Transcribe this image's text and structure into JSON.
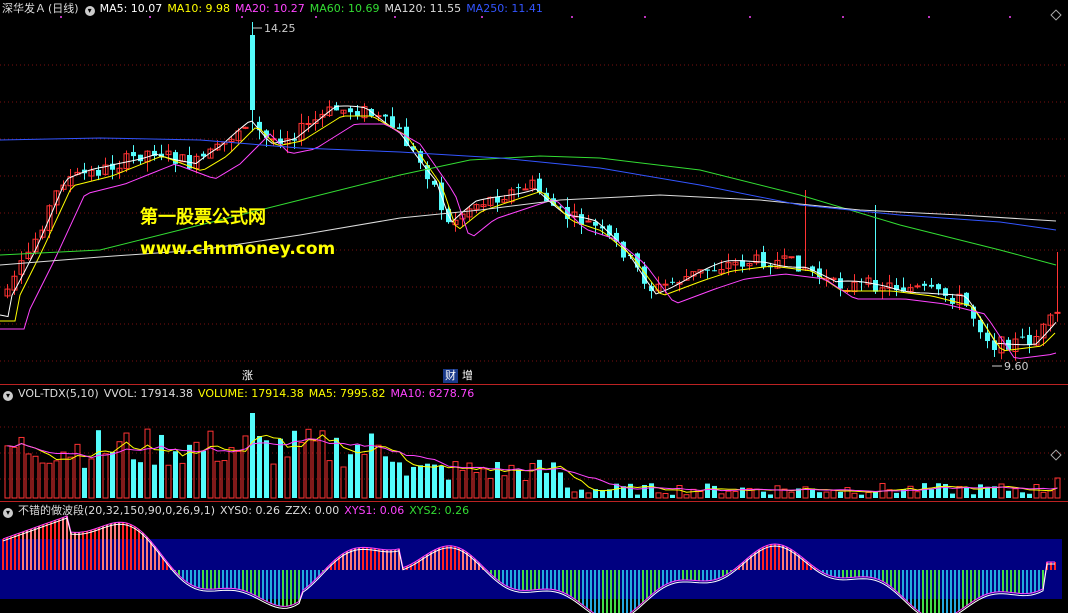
{
  "main": {
    "stock_name": "深华发Ａ",
    "period": "(日线)",
    "ma_labels": [
      {
        "text": "MA5: 10.07",
        "color": "#ffffff"
      },
      {
        "text": "MA10: 9.98",
        "color": "#ffff00"
      },
      {
        "text": "MA20: 10.27",
        "color": "#ff44ff"
      },
      {
        "text": "MA60: 10.69",
        "color": "#33dd33"
      },
      {
        "text": "MA120: 11.55",
        "color": "#dddddd"
      },
      {
        "text": "MA250: 11.41",
        "color": "#3355ff"
      }
    ],
    "high_label": "14.25",
    "low_label": "9.60",
    "watermark_title": "第一股票公式网",
    "watermark_url": "www.chnmoney.com",
    "markers": {
      "zhang": "涨",
      "cai": "财",
      "zeng": "增"
    }
  },
  "volume": {
    "labels": [
      {
        "text": "VOL-TDX(5,10)",
        "color": "#dddddd"
      },
      {
        "text": "VVOL: 17914.38",
        "color": "#dddddd"
      },
      {
        "text": "VOLUME: 17914.38",
        "color": "#ffff00"
      },
      {
        "text": "MA5: 7995.82",
        "color": "#ffff00"
      },
      {
        "text": "MA10: 6278.76",
        "color": "#ff44ff"
      }
    ]
  },
  "indicator": {
    "labels": [
      {
        "text": "不错的做波段(20,32,150,90,0,26,9,1)",
        "color": "#dddddd"
      },
      {
        "text": "XYS0: 0.26",
        "color": "#dddddd"
      },
      {
        "text": "ZZX: 0.00",
        "color": "#dddddd"
      },
      {
        "text": "XYS1: 0.06",
        "color": "#ff44ff"
      },
      {
        "text": "XYS2: 0.26",
        "color": "#33dd33"
      }
    ]
  },
  "colors": {
    "up": "#ff3333",
    "down": "#54fcfc",
    "bg": "#000000",
    "grid": "#7a1010",
    "band": "#000080"
  },
  "icons": [
    "settings-circle-icon",
    "diamond-icon"
  ]
}
